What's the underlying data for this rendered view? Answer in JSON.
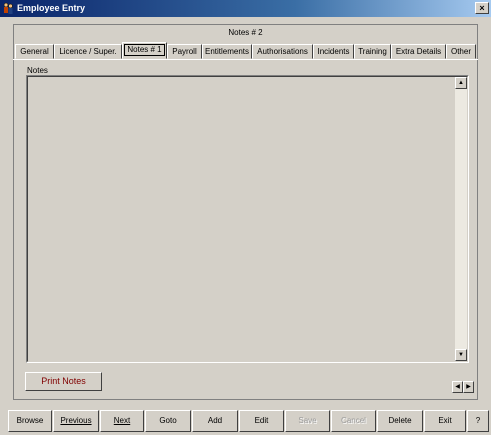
{
  "window": {
    "title": "Employee Entry",
    "close_glyph": "×",
    "app_icon": "people-icon"
  },
  "header": {
    "label": "Notes # 2"
  },
  "tabs": [
    {
      "label": "General"
    },
    {
      "label": "Licence / Super."
    },
    {
      "label": "Notes # 1",
      "active": true
    },
    {
      "label": "Payroll"
    },
    {
      "label": "Entitlements"
    },
    {
      "label": "Authorisations"
    },
    {
      "label": "Incidents"
    },
    {
      "label": "Training"
    },
    {
      "label": "Extra Details"
    },
    {
      "label": "Other"
    }
  ],
  "notes": {
    "label": "Notes",
    "value": ""
  },
  "scroll": {
    "up": "▲",
    "down": "▼",
    "left": "◀",
    "right": "▶"
  },
  "print_button": {
    "label": "Print Notes"
  },
  "bottom": {
    "browse": "Browse",
    "previous": "Previous",
    "next": "Next",
    "goto": "Goto",
    "add": "Add",
    "edit": "Edit",
    "save": "Save",
    "cancel": "Cancel",
    "delete": "Delete",
    "exit": "Exit",
    "help": "?"
  },
  "colors": {
    "face": "#d4d0c8",
    "title_start": "#0a246a",
    "print_text": "#800000"
  }
}
